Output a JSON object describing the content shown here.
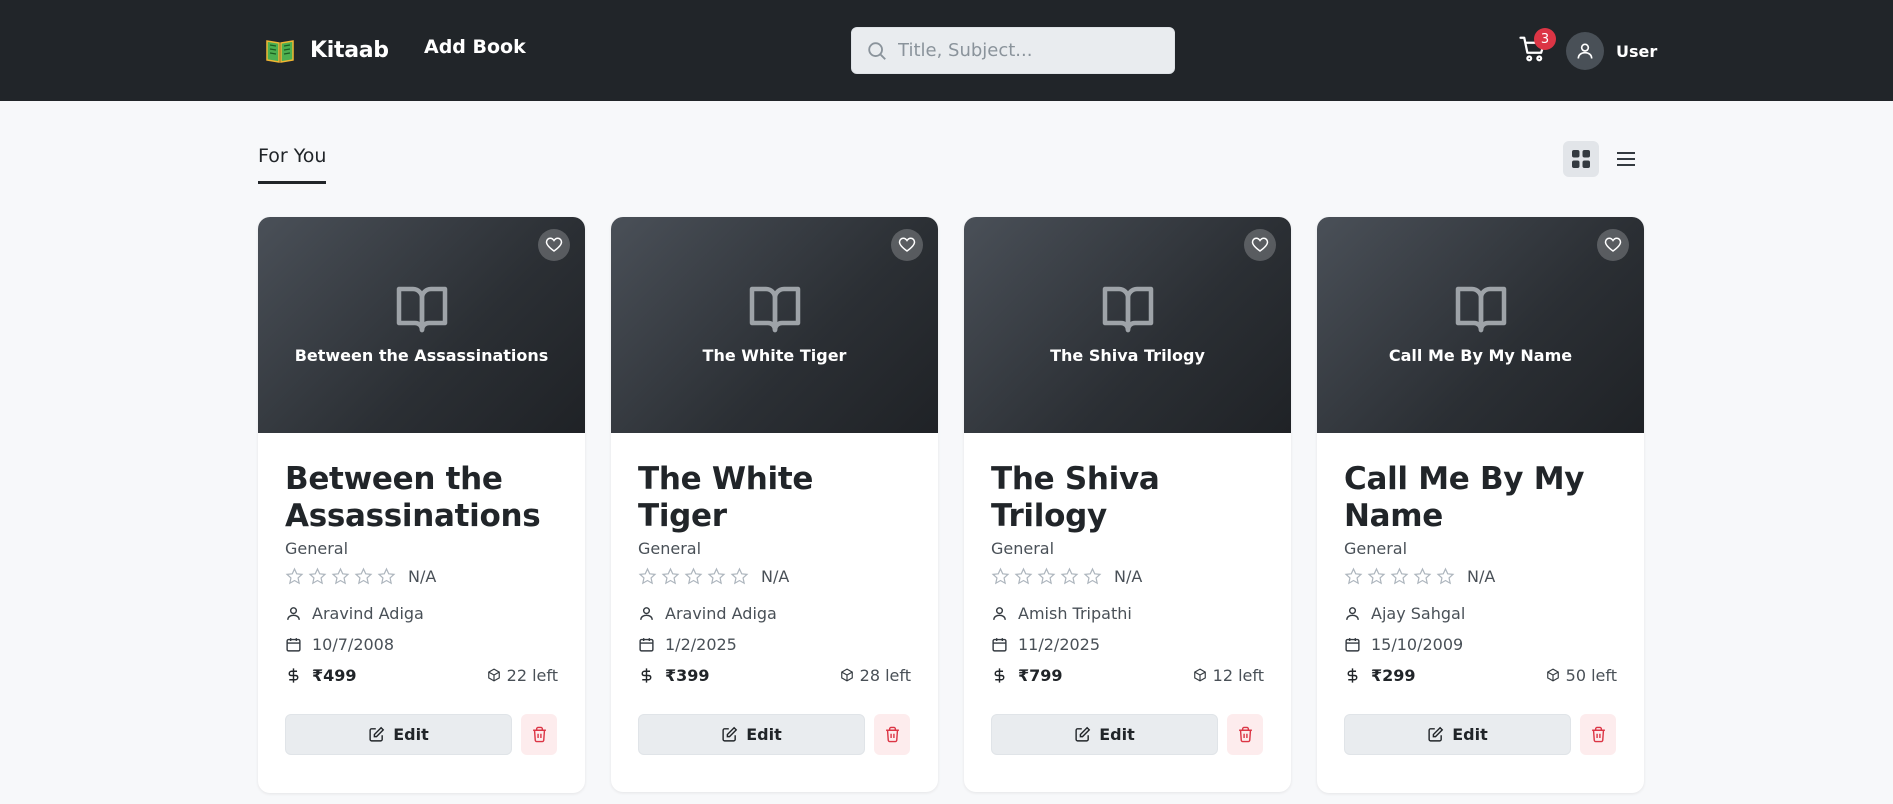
{
  "navbar": {
    "brand": "Kitaab",
    "add_book": "Add Book",
    "search_placeholder": "Title, Subject...",
    "cart_count": "3",
    "user": "User"
  },
  "section": {
    "tab": "For You"
  },
  "books": [
    {
      "cover_title": "Between the Assassinations",
      "title": "Between the Assassinations",
      "genre": "General",
      "rating": "N/A",
      "author": "Aravind Adiga",
      "date": "10/7/2008",
      "price": "₹499",
      "stock": "22 left",
      "edit": "Edit"
    },
    {
      "cover_title": "The White Tiger",
      "title": "The White Tiger",
      "genre": "General",
      "rating": "N/A",
      "author": "Aravind Adiga",
      "date": "1/2/2025",
      "price": "₹399",
      "stock": "28 left",
      "edit": "Edit"
    },
    {
      "cover_title": "The Shiva Trilogy",
      "title": "The Shiva Trilogy",
      "genre": "General",
      "rating": "N/A",
      "author": "Amish Tripathi",
      "date": "11/2/2025",
      "price": "₹799",
      "stock": "12 left",
      "edit": "Edit"
    },
    {
      "cover_title": "Call Me By My Name",
      "title": "Call Me By My Name",
      "genre": "General",
      "rating": "N/A",
      "author": "Ajay Sahgal",
      "date": "15/10/2009",
      "price": "₹299",
      "stock": "50 left",
      "edit": "Edit"
    }
  ],
  "colors": {
    "navbar": "#212529",
    "badge": "#dc3545",
    "delete": "#dc3545",
    "brand_book_green": "#4caf50",
    "brand_book_gold": "#f2b632"
  },
  "icons": {
    "brand": "open-book-icon",
    "search": "search-icon",
    "cart": "cart-icon",
    "avatar": "user-icon",
    "grid_view": "grid-icon",
    "list_view": "list-icon",
    "favorite": "heart-icon",
    "cover": "book-icon",
    "star": "star-icon",
    "author": "person-icon",
    "date": "calendar-icon",
    "price": "dollar-icon",
    "stock": "box-icon",
    "edit": "edit-icon",
    "delete": "trash-icon"
  }
}
